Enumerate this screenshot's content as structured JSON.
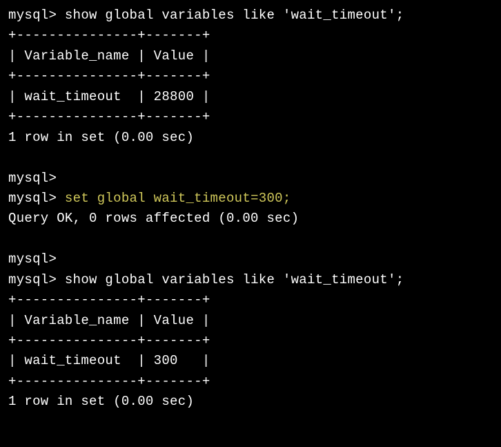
{
  "session": {
    "prompt": "mysql>",
    "blocks": [
      {
        "type": "command",
        "highlighted": false,
        "text": " show global variables like 'wait_timeout';"
      },
      {
        "type": "table",
        "border_top": "+---------------+-------+",
        "header": "| Variable_name | Value |",
        "border_mid": "+---------------+-------+",
        "row": "| wait_timeout  | 28800 |",
        "border_bot": "+---------------+-------+",
        "footer": "1 row in set (0.00 sec)"
      },
      {
        "type": "blank"
      },
      {
        "type": "prompt_only"
      },
      {
        "type": "command",
        "highlighted": true,
        "text": " set global wait_timeout=300;"
      },
      {
        "type": "result",
        "text": "Query OK, 0 rows affected (0.00 sec)"
      },
      {
        "type": "blank"
      },
      {
        "type": "prompt_only"
      },
      {
        "type": "command",
        "highlighted": false,
        "text": " show global variables like 'wait_timeout';"
      },
      {
        "type": "table",
        "border_top": "+---------------+-------+",
        "header": "| Variable_name | Value |",
        "border_mid": "+---------------+-------+",
        "row": "| wait_timeout  | 300   |",
        "border_bot": "+---------------+-------+",
        "footer": "1 row in set (0.00 sec)"
      }
    ]
  }
}
